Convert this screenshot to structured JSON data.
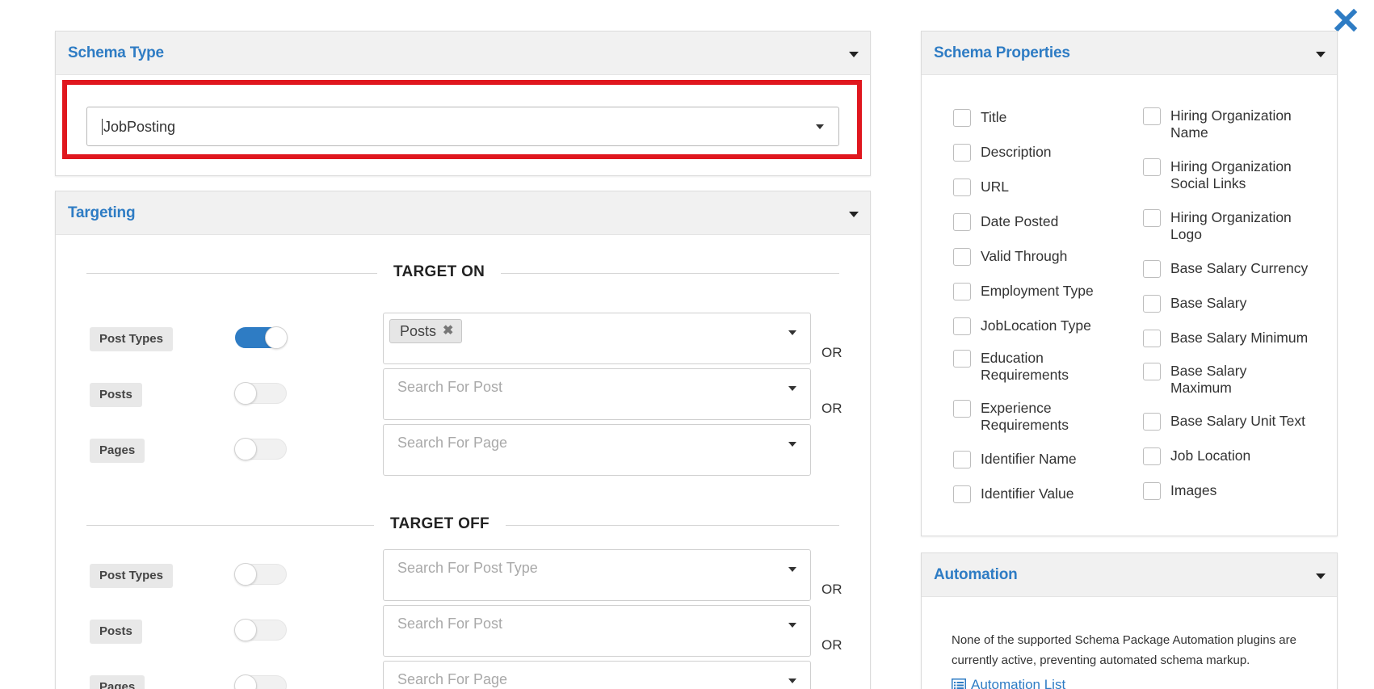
{
  "close": {
    "icon": "close-icon"
  },
  "schema_type": {
    "title": "Schema Type",
    "selected": "JobPosting"
  },
  "targeting": {
    "title": "Targeting",
    "target_on": {
      "heading": "TARGET ON",
      "rows": [
        {
          "label": "Post Types",
          "toggle_on": true,
          "chip": "Posts",
          "placeholder": "",
          "or": "OR"
        },
        {
          "label": "Posts",
          "toggle_on": false,
          "placeholder": "Search For Post",
          "or": "OR"
        },
        {
          "label": "Pages",
          "toggle_on": false,
          "placeholder": "Search For Page",
          "or": ""
        }
      ]
    },
    "target_off": {
      "heading": "TARGET OFF",
      "rows": [
        {
          "label": "Post Types",
          "toggle_on": false,
          "placeholder": "Search For Post Type",
          "or": "OR"
        },
        {
          "label": "Posts",
          "toggle_on": false,
          "placeholder": "Search For Post",
          "or": "OR"
        },
        {
          "label": "Pages",
          "toggle_on": false,
          "placeholder": "Search For Page",
          "or": ""
        }
      ]
    }
  },
  "schema_properties": {
    "title": "Schema Properties",
    "left": [
      "Title",
      "Description",
      "URL",
      "Date Posted",
      "Valid Through",
      "Employment Type",
      "JobLocation Type",
      "Education Requirements",
      "Experience Requirements",
      "Identifier Name",
      "Identifier Value"
    ],
    "right": [
      "Hiring Organization Name",
      "Hiring Organization Social Links",
      "Hiring Organization Logo",
      "Base Salary Currency",
      "Base Salary",
      "Base Salary Minimum",
      "Base Salary Maximum",
      "Base Salary Unit Text",
      "Job Location",
      "Images"
    ]
  },
  "automation": {
    "title": "Automation",
    "text": "None of the supported Schema Package Automation plugins are currently active, preventing automated schema markup.",
    "link": "Automation List"
  },
  "colors": {
    "accent": "#2e7cc4",
    "highlight": "#e0171e"
  }
}
